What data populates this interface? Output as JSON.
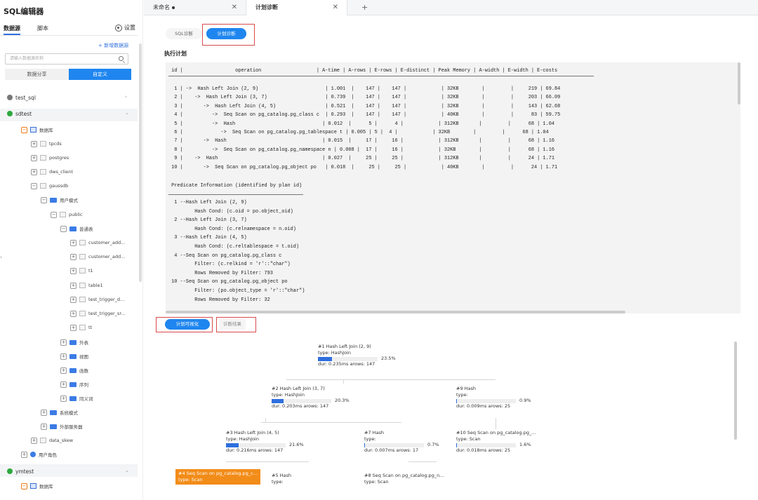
{
  "app": {
    "title": "SQL编辑器"
  },
  "sidebar": {
    "tabs": [
      "数据源",
      "脚本"
    ],
    "settings_label": "设置",
    "add_datasource": "+ 新增数据源",
    "search_placeholder": "请输入数据源名称",
    "segments": [
      "数据分享",
      "自定义"
    ],
    "tree": [
      {
        "label": "test_sql",
        "level": 0,
        "icon": "gray-db-dot",
        "chevron": "›"
      },
      {
        "label": "sdtest",
        "level": 0,
        "icon": "green-db-dot",
        "chevron": "⌄"
      },
      {
        "label": "数据库",
        "level": 1,
        "toggle": "−",
        "icon": "database-icon"
      },
      {
        "label": "tpcds",
        "level": 2,
        "toggle": "+",
        "icon": "db-gray-icon"
      },
      {
        "label": "postgres",
        "level": 2,
        "toggle": "+",
        "icon": "db-gray-icon"
      },
      {
        "label": "dws_client",
        "level": 2,
        "toggle": "+",
        "icon": "db-gray-icon"
      },
      {
        "label": "gaussdb",
        "level": 2,
        "toggle": "−",
        "icon": "db-gray-icon"
      },
      {
        "label": "用户模式",
        "level": 3,
        "toggle": "−",
        "icon": "folder-icon"
      },
      {
        "label": "public",
        "level": 4,
        "toggle": "−",
        "icon": "db-gray-icon"
      },
      {
        "label": "普通表",
        "level": 5,
        "toggle": "−",
        "icon": "folder-icon"
      },
      {
        "label": "customer_add...",
        "level": 6,
        "toggle": "+",
        "icon": "table-icon"
      },
      {
        "label": "customer_add...",
        "level": 6,
        "toggle": "+",
        "icon": "table-icon"
      },
      {
        "label": "t1",
        "level": 6,
        "toggle": "+",
        "icon": "table-icon"
      },
      {
        "label": "table1",
        "level": 6,
        "toggle": "+",
        "icon": "table-icon"
      },
      {
        "label": "test_trigger_d...",
        "level": 6,
        "toggle": "+",
        "icon": "table-icon"
      },
      {
        "label": "test_trigger_sr...",
        "level": 6,
        "toggle": "+",
        "icon": "table-icon"
      },
      {
        "label": "tt",
        "level": 6,
        "toggle": "+",
        "icon": "table-icon"
      },
      {
        "label": "外表",
        "level": 5,
        "toggle": "+",
        "icon": "folder-icon"
      },
      {
        "label": "视图",
        "level": 5,
        "toggle": "+",
        "icon": "folder-icon"
      },
      {
        "label": "函数",
        "level": 5,
        "toggle": "+",
        "icon": "folder-icon"
      },
      {
        "label": "序列",
        "level": 5,
        "toggle": "+",
        "icon": "folder-icon"
      },
      {
        "label": "同义词",
        "level": 5,
        "toggle": "+",
        "icon": "folder-icon"
      },
      {
        "label": "系统模式",
        "level": 3,
        "toggle": "+",
        "icon": "folder-icon"
      },
      {
        "label": "外部服务器",
        "level": 3,
        "toggle": "+",
        "icon": "folder-icon"
      },
      {
        "label": "data_skew",
        "level": 2,
        "toggle": "+",
        "icon": "db-gray-icon"
      },
      {
        "label": "用户角色",
        "level": 1,
        "toggle": "+",
        "icon": "user-icon"
      },
      {
        "label": "ymtest",
        "level": 0,
        "icon": "green-db-dot",
        "chevron": "⌄"
      },
      {
        "label": "数据库",
        "level": 1,
        "toggle": "−",
        "icon": "database-icon"
      }
    ]
  },
  "tabs": [
    {
      "label": "未命名",
      "modified": true
    },
    {
      "label": "计划诊断",
      "modified": false
    }
  ],
  "diagnosis": {
    "buttons": [
      "SQL诊断",
      "计划诊断"
    ],
    "section_title": "执行计划",
    "plan_header": " id |                  operation                   | A-time | A-rows | E-rows | E-distinct | Peak Memory | A-width | E-width | E-costs",
    "plan_rows": [
      "  1 | ->  Hash Left Join (2, 9)                       | 1.001  |    147 |    147 |            | 32KB        |         |     219 | 69.84",
      "  2 |    ->  Hash Left Join (3, 7)                    | 0.739  |    147 |    147 |            | 32KB        |         |     203 | 66.09",
      "  3 |       ->  Hash Left Join (4, 5)                 | 0.521  |    147 |    147 |            | 32KB        |         |     143 | 62.68",
      "  4 |          ->  Seq Scan on pg_catalog.pg_class c  | 0.293  |    147 |    147 |            | 40KB        |         |      83 | 59.75",
      "  5 |          ->  Hash                              | 0.012  |      5 |      4 |            | 312KB       |         |      68 | 1.04",
      "  6 |             ->  Seq Scan on pg_catalog.pg_tablespace t | 0.005 | 5 |  4 |            | 32KB        |         |      68 | 1.04",
      "  7 |       ->  Hash                                 | 0.015  |     17 |     16 |            | 312KB       |         |      68 | 1.16",
      "  8 |          ->  Seq Scan on pg_catalog.pg_namespace n | 0.008 |  17 |     16 |            | 32KB        |         |      68 | 1.16",
      "  9 |    ->  Hash                                    | 0.027  |     25 |     25 |            | 312KB       |         |      24 | 1.71",
      " 10 |       ->  Seq Scan on pg_catalog.pg_object po   | 0.018  |     25 |     25 |            | 40KB        |         |      24 | 1.71"
    ],
    "predicate_title": " Predicate Information (identified by plan id)",
    "predicate_lines": [
      "  1 --Hash Left Join (2, 9)",
      "         Hash Cond: (c.oid = po.object_oid)",
      "  2 --Hash Left Join (3, 7)",
      "         Hash Cond: (c.relnamespace = n.oid)",
      "  3 --Hash Left Join (4, 5)",
      "         Hash Cond: (c.reltablespace = t.oid)",
      "  4 --Seq Scan on pg_catalog.pg_class c",
      "         Filter: (c.relkind = 'r'::\"char\")",
      "         Rows Removed by Filter: 793",
      " 10 --Seq Scan on pg_catalog.pg_object po",
      "         Filter: (po.object_type = 'r'::\"char\")",
      "         Rows Removed by Filter: 32"
    ],
    "vis_buttons": [
      "计划可视化",
      "诊断结果"
    ]
  },
  "plan_tree": {
    "nodes": [
      {
        "id": "n1",
        "title": "#1 Hash Left Join (2, 9)",
        "type": "type: HashJoin",
        "pct": "23.5%",
        "fraction": 0.235,
        "stats": "dur: 0.235ms arows: 147"
      },
      {
        "id": "n2",
        "title": "#2 Hash Left Join (3, 7)",
        "type": "type: HashJoin",
        "pct": "20.3%",
        "fraction": 0.203,
        "stats": "dur: 0.203ms arows: 147"
      },
      {
        "id": "n9",
        "title": "#9 Hash",
        "type": "type:",
        "pct": "0.9%",
        "fraction": 0.009,
        "stats": "dur: 0.009ms arows: 25"
      },
      {
        "id": "n3",
        "title": "#3 Hash Left Join (4, 5)",
        "type": "type: HashJoin",
        "pct": "21.6%",
        "fraction": 0.216,
        "stats": "dur: 0.216ms arows: 147"
      },
      {
        "id": "n7",
        "title": "#7 Hash",
        "type": "type:",
        "pct": "0.7%",
        "fraction": 0.007,
        "stats": "dur: 0.007ms arows: 17"
      },
      {
        "id": "n10",
        "title": "#10 Seq Scan on pg_catalog.pg_...",
        "type": "type: Scan",
        "pct": "1.6%",
        "fraction": 0.016,
        "stats": "dur: 0.018ms arows: 25"
      },
      {
        "id": "n4",
        "title": "#4 Seq Scan on pg_catalog.pg_c...",
        "type": "type: Scan"
      },
      {
        "id": "n5",
        "title": "#5 Hash",
        "type": "type:"
      },
      {
        "id": "n8",
        "title": "#8 Seq Scan on pg_catalog.pg_n...",
        "type": "type: Scan"
      }
    ],
    "colors": {
      "bar": "#2f6fde",
      "highlight": "#f28c18"
    }
  }
}
